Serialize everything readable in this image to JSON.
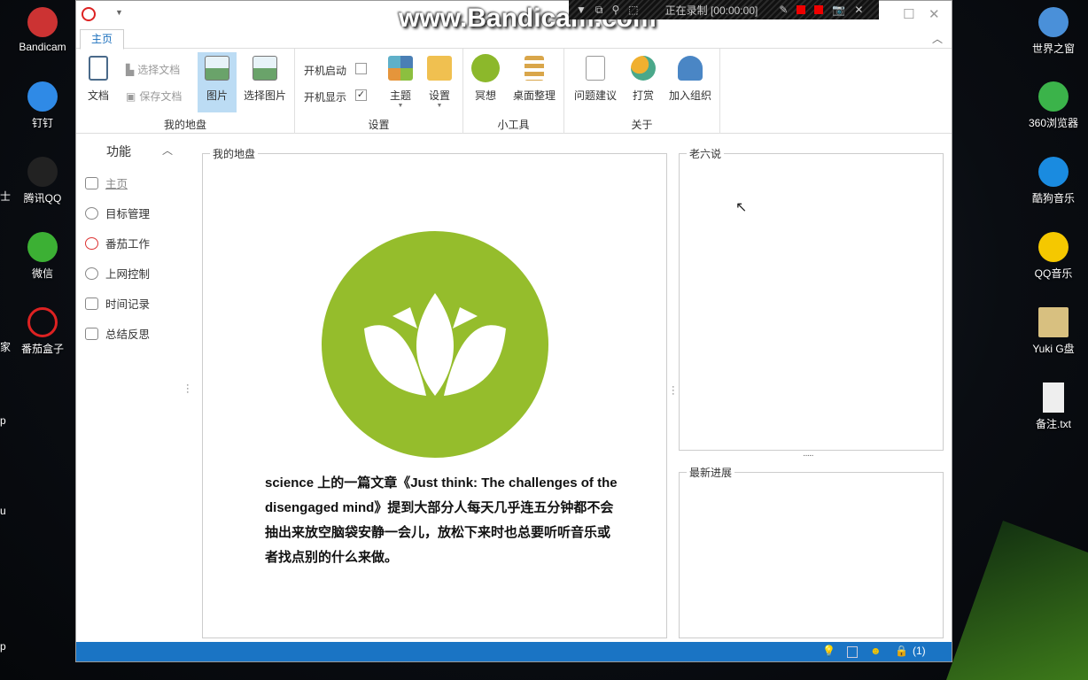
{
  "desktop": {
    "left": [
      "Bandicam",
      "钉钉",
      "腾讯QQ",
      "微信",
      "番茄盒子"
    ],
    "left_edge": [
      "士",
      "家",
      "p",
      "u",
      "p"
    ],
    "right": [
      "世界之窗",
      "360浏览器",
      "酷狗音乐",
      "QQ音乐",
      "Yuki G盘",
      "备注.txt"
    ]
  },
  "recorder": {
    "watermark": "www.Bandicam.com",
    "status": "正在录制 [00:00:00]"
  },
  "window": {
    "tab": "主页"
  },
  "ribbon": {
    "doc": "文档",
    "select_doc": "选择文档",
    "save_doc": "保存文档",
    "image": "图片",
    "select_image": "选择图片",
    "group1": "我的地盘",
    "autostart": "开机启动",
    "autostart_checked": false,
    "show_on_start": "开机显示",
    "show_on_start_checked": true,
    "theme": "主题",
    "settings": "设置",
    "group2": "设置",
    "meditate": "冥想",
    "desktop_organize": "桌面整理",
    "group3": "小工具",
    "feedback": "问题建议",
    "donate": "打赏",
    "join": "加入组织",
    "group4": "关于"
  },
  "sidebar": {
    "title": "功能",
    "items": [
      "主页",
      "目标管理",
      "番茄工作",
      "上网控制",
      "时间记录",
      "总结反思"
    ]
  },
  "main": {
    "title": "我的地盘",
    "quote": "science 上的一篇文章《Just think: The challenges of the disengaged mind》提到大部分人每天几乎连五分钟都不会抽出来放空脑袋安静一会儿，放松下来时也总要听听音乐或者找点别的什么来做。"
  },
  "right": {
    "top_title": "老六说",
    "bottom_title": "最新进展"
  },
  "statusbar": {
    "count": "(1)"
  },
  "colors": {
    "accent": "#1a74c4",
    "lotus": "#95bd2c"
  }
}
